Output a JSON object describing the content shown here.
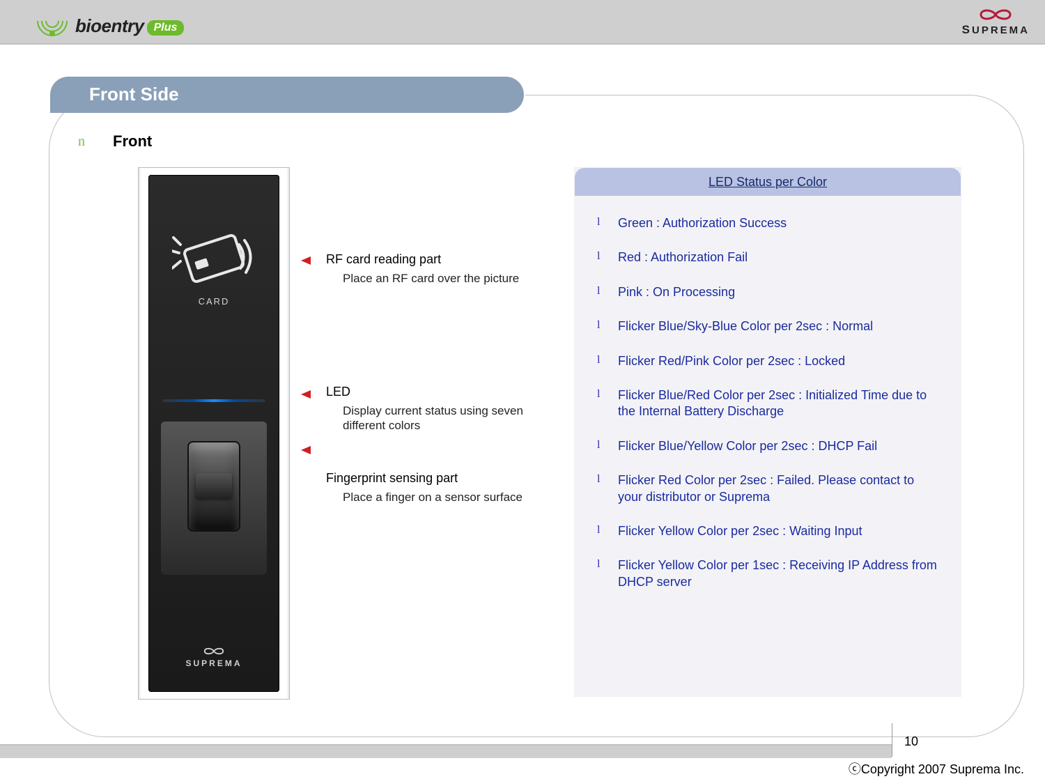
{
  "header": {
    "brand_main": "bioentry",
    "brand_tag": "Plus",
    "suprema": "SUPREMA"
  },
  "title_pill": "Front Side",
  "section": {
    "bullet": "n",
    "title": "Front"
  },
  "device": {
    "card_label": "CARD",
    "brand": "SUPREMA"
  },
  "callouts": {
    "rf": {
      "title": "RF card reading part",
      "desc": "Place an RF card over the picture"
    },
    "led": {
      "title": "LED",
      "desc": "Display current status using seven different colors"
    },
    "fp": {
      "title": "Fingerprint sensing part",
      "desc": "Place a finger on a sensor surface"
    }
  },
  "led_box": {
    "title": "LED Status per Color",
    "bullet": "l",
    "items": [
      "Green : Authorization Success",
      "Red : Authorization Fail",
      "Pink : On Processing",
      "Flicker Blue/Sky-Blue Color per 2sec : Normal",
      "Flicker Red/Pink Color per 2sec : Locked",
      "Flicker Blue/Red Color per 2sec : Initialized Time  due to the Internal Battery Discharge",
      "Flicker Blue/Yellow Color per 2sec : DHCP Fail",
      "Flicker Red Color per 2sec : Failed. Please contact to your distributor or Suprema",
      "Flicker Yellow Color per 2sec : Waiting Input",
      "Flicker Yellow Color per 1sec : Receiving IP Address from DHCP server"
    ]
  },
  "footer": {
    "page": "10",
    "copyright": "ⓒCopyright 2007 Suprema Inc."
  }
}
